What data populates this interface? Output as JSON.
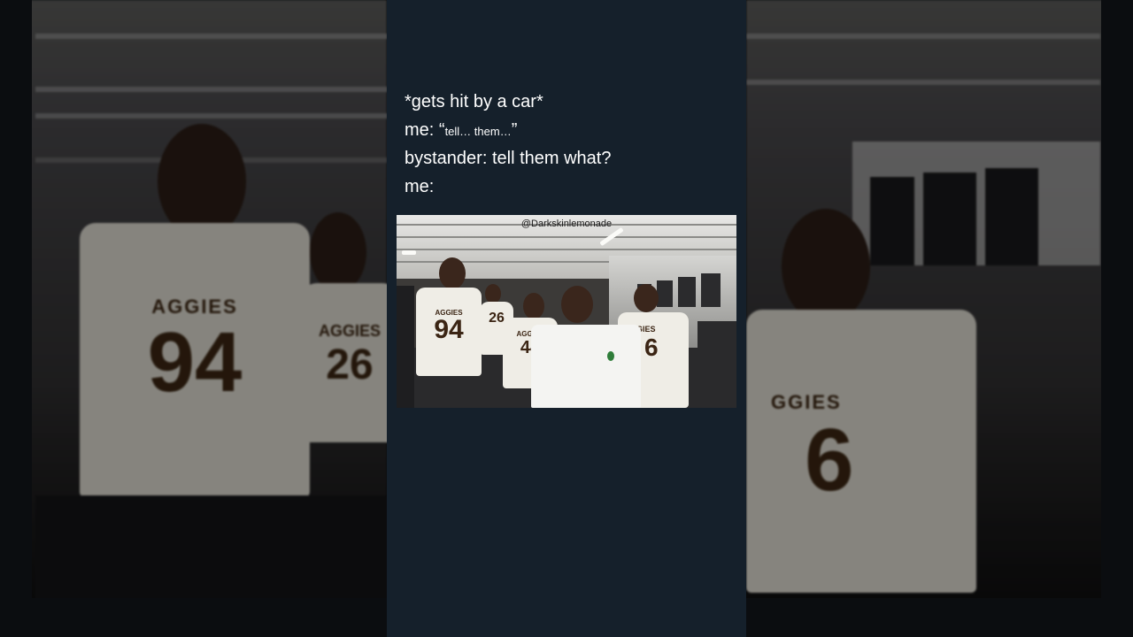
{
  "meme": {
    "line1": "*gets hit by a car*",
    "line2_prefix": "me: “",
    "line2_small": "tell… them…",
    "line2_suffix": "”",
    "line3": "bystander: tell them what?",
    "line4": "me:"
  },
  "media": {
    "watermark": "@Darkskinlemonade",
    "jerseys": {
      "team_word": "AGGIES",
      "team_word_partial": "AGGIES",
      "team_word_right": "GGIES",
      "numbers": [
        "94",
        "26",
        "44",
        "6",
        "6"
      ]
    }
  },
  "colors": {
    "card_background": "#15202b",
    "page_background": "#0b0d10",
    "text": "#ffffff"
  }
}
